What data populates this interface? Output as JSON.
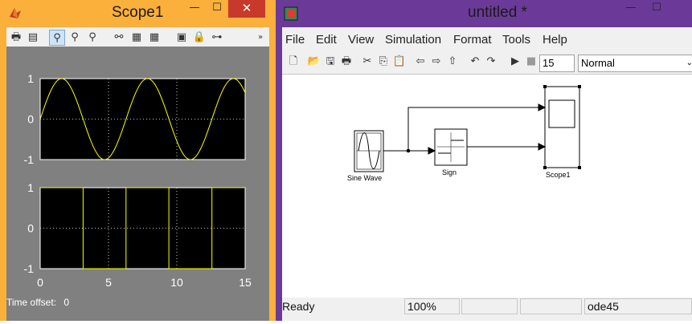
{
  "scope_window": {
    "title": "Scope1",
    "app_icon": "matlab-icon",
    "caption_buttons": {
      "minimize": "—",
      "maximize": "☐",
      "close": "✕"
    },
    "toolbar": [
      "print-icon",
      "parameters-icon",
      "zoom-icon",
      "zoom-x-icon",
      "zoom-y-icon",
      "binoculars-icon",
      "save-axes-icon",
      "restore-axes-icon",
      "floating-scope-icon",
      "lock-icon",
      "signal-selection-icon",
      "overflow-chevron-icon"
    ],
    "plots": [
      {
        "y_ticks": [
          "1",
          "0",
          "-1"
        ]
      },
      {
        "y_ticks": [
          "1",
          "0",
          "-1"
        ]
      }
    ],
    "x_ticks": [
      "0",
      "5",
      "10",
      "15"
    ],
    "time_offset_label": "Time offset:",
    "time_offset_value": "0",
    "colors": {
      "background": "#808080",
      "plot_bg": "#000000",
      "trace": "#ffff00",
      "grid": "#ffffff"
    }
  },
  "chart_data": [
    {
      "type": "line",
      "series": [
        {
          "values_note": "",
          "x": [
            0,
            0.79,
            1.57,
            2.36,
            3.14,
            3.93,
            4.71,
            5.5,
            6.28,
            7.07,
            7.85,
            8.64,
            9.42,
            10.21,
            11.0,
            11.78,
            12.57,
            13.35,
            14.14,
            14.92,
            15
          ],
          "y": [
            0,
            0.71,
            1,
            0.71,
            0,
            -0.71,
            -1,
            -0.71,
            0,
            0.71,
            1,
            0.71,
            0,
            -0.71,
            -1,
            -0.71,
            0,
            0.71,
            1,
            0.71,
            0.65
          ]
        }
      ],
      "xlim": [
        0,
        15
      ],
      "ylim": [
        -1,
        1
      ],
      "grid": true
    },
    {
      "type": "line",
      "series": [
        {
          "x": [
            0,
            3.14,
            3.14,
            6.28,
            6.28,
            9.42,
            9.42,
            12.57,
            12.57,
            15
          ],
          "y": [
            1,
            1,
            -1,
            -1,
            1,
            1,
            -1,
            -1,
            1,
            1
          ]
        }
      ],
      "xlim": [
        0,
        15
      ],
      "ylim": [
        -1,
        1
      ],
      "grid": true
    }
  ],
  "model_window": {
    "title": "untitled *",
    "app_icon": "simulink-icon",
    "caption_buttons": {
      "minimize": "—",
      "maximize": "☐"
    },
    "menu": [
      "File",
      "Edit",
      "View",
      "Simulation",
      "Format",
      "Tools",
      "Help"
    ],
    "toolbar": [
      "new-icon",
      "open-icon",
      "save-icon",
      "print-icon",
      "cut-icon",
      "copy-icon",
      "paste-icon",
      "back-icon",
      "forward-icon",
      "up-icon",
      "undo-icon",
      "redo-icon",
      "run-icon",
      "stop-icon"
    ],
    "stop_time": "15",
    "sim_mode": "Normal",
    "blocks": {
      "sine": "Sine Wave",
      "sign": "Sign",
      "scope": "Scope1"
    },
    "status": {
      "state": "Ready",
      "zoom": "100%",
      "cell3": "",
      "cell4": "",
      "solver": "ode45"
    }
  }
}
